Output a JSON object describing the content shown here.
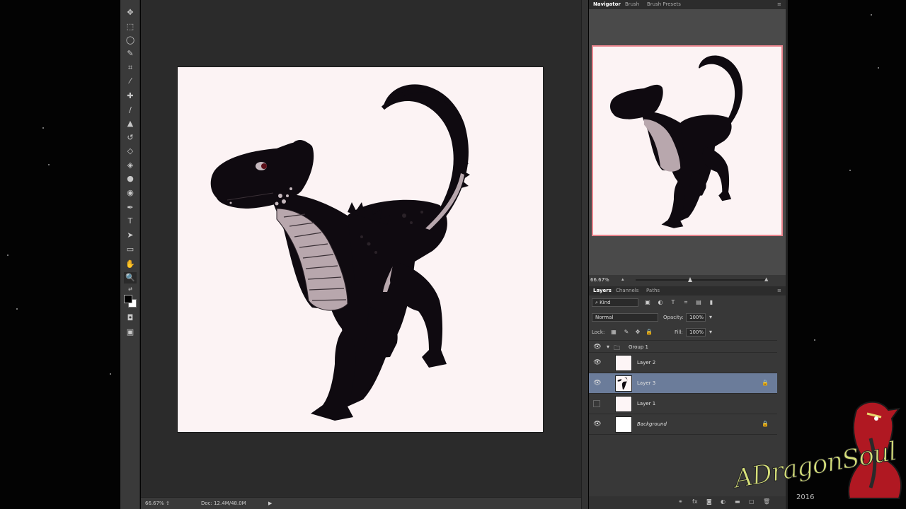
{
  "navigator_panel": {
    "tabs": [
      {
        "label": "Navigator",
        "active": true
      },
      {
        "label": "Brush",
        "active": false
      },
      {
        "label": "Brush Presets",
        "active": false
      }
    ],
    "zoom": "66.67%"
  },
  "layers_panel": {
    "tabs": [
      {
        "label": "Layers",
        "active": true
      },
      {
        "label": "Channels",
        "active": false
      },
      {
        "label": "Paths",
        "active": false
      }
    ],
    "filter_kind": "Kind",
    "blend_mode": "Normal",
    "opacity_label": "Opacity:",
    "opacity_value": "100%",
    "lock_label": "Lock:",
    "fill_label": "Fill:",
    "fill_value": "100%",
    "layers": [
      {
        "name": "Group 1",
        "visible": true,
        "type": "group",
        "selected": false,
        "locked": false,
        "italic": false
      },
      {
        "name": "Layer 2",
        "visible": true,
        "type": "layer",
        "selected": false,
        "locked": false,
        "italic": false
      },
      {
        "name": "Layer 3",
        "visible": true,
        "type": "layer",
        "selected": true,
        "locked": true,
        "italic": false
      },
      {
        "name": "Layer 1",
        "visible": false,
        "type": "layer",
        "selected": false,
        "locked": false,
        "italic": false
      },
      {
        "name": "Background",
        "visible": true,
        "type": "layer",
        "selected": false,
        "locked": true,
        "italic": true
      }
    ]
  },
  "status_bar": {
    "zoom": "66.67%",
    "doc_info": "Doc: 12.4M/48.0M"
  },
  "watermark": {
    "text": "ADragonSoul",
    "year": "2016"
  },
  "colors": {
    "canvas_bg": "#fcf3f4",
    "selected_layer": "#6b7c9a",
    "navigator_frame": "#e8838c",
    "dragon_body": "#0f0a10",
    "dragon_belly": "#b8a7ad"
  },
  "tools": [
    "move-icon",
    "marquee-icon",
    "lasso-icon",
    "quick-select-icon",
    "crop-icon",
    "eyedropper-icon",
    "healing-brush-icon",
    "brush-icon",
    "stamp-icon",
    "history-brush-icon",
    "eraser-icon",
    "paint-bucket-icon",
    "blur-icon",
    "dodge-icon",
    "pen-icon",
    "type-icon",
    "path-select-icon",
    "rectangle-icon",
    "hand-icon",
    "zoom-icon"
  ]
}
